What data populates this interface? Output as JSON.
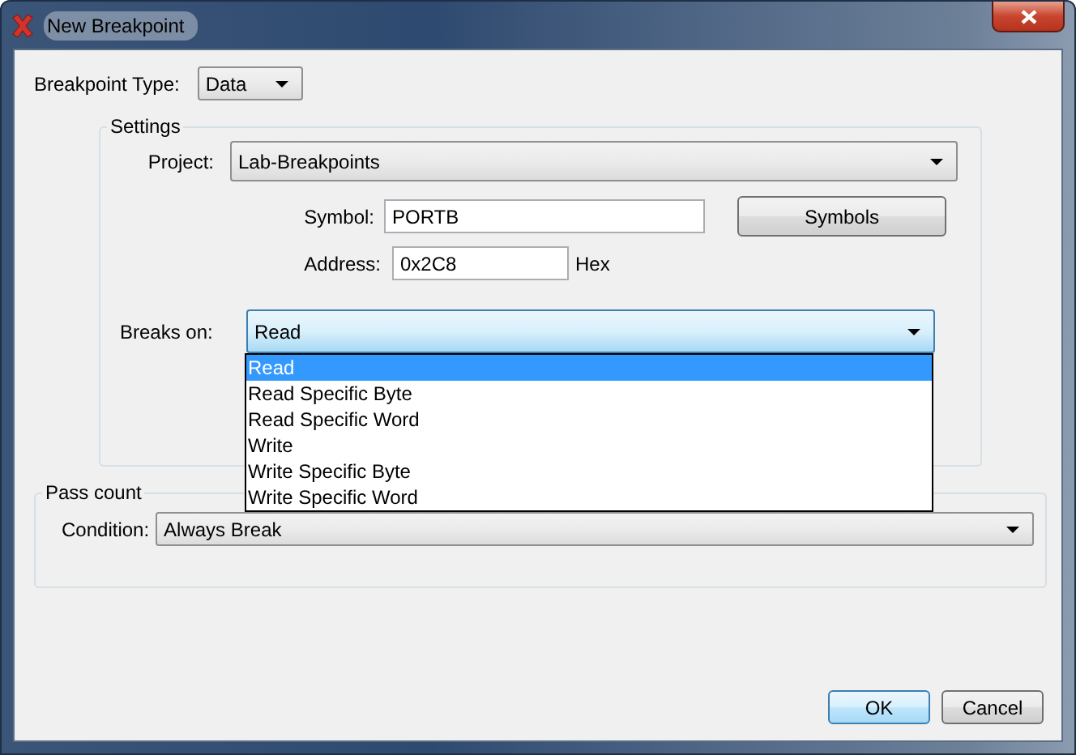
{
  "window": {
    "title": "New Breakpoint"
  },
  "breakpoint_type": {
    "label": "Breakpoint Type:",
    "value": "Data"
  },
  "settings": {
    "title": "Settings",
    "project": {
      "label": "Project:",
      "value": "Lab-Breakpoints"
    },
    "symbol": {
      "label": "Symbol:",
      "value": "PORTB"
    },
    "symbols_button": "Symbols",
    "address": {
      "label": "Address:",
      "value": "0x2C8",
      "unit": "Hex"
    },
    "breaks_on": {
      "label": "Breaks on:",
      "value": "Read",
      "expanded": true,
      "options": [
        {
          "label": "Read",
          "selected": true
        },
        {
          "label": "Read Specific Byte",
          "selected": false
        },
        {
          "label": "Read Specific Word",
          "selected": false
        },
        {
          "label": "Write",
          "selected": false
        },
        {
          "label": "Write Specific Byte",
          "selected": false
        },
        {
          "label": "Write Specific Word",
          "selected": false
        }
      ]
    }
  },
  "pass_count": {
    "title": "Pass count",
    "condition": {
      "label": "Condition:",
      "value": "Always Break"
    }
  },
  "buttons": [
    {
      "label": "OK",
      "default": true
    },
    {
      "label": "Cancel",
      "default": false
    }
  ]
}
